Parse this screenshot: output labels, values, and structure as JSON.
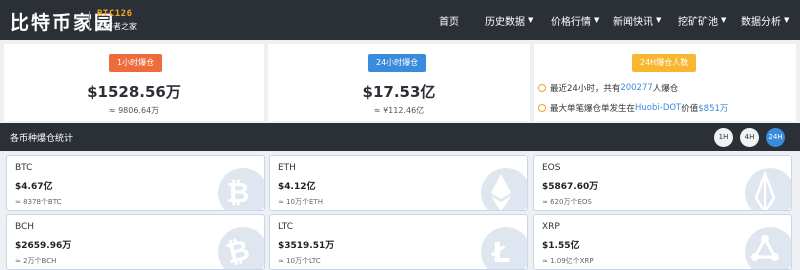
{
  "header": {
    "logo_text": "比特币家园",
    "logo_sub_en": "BTC126",
    "logo_sub_cn": "爱好者之家",
    "nav": [
      {
        "label": "首页",
        "caret": false
      },
      {
        "label": "历史数据",
        "caret": true
      },
      {
        "label": "价格行情",
        "caret": true
      },
      {
        "label": "新闻快讯",
        "caret": true
      },
      {
        "label": "挖矿矿池",
        "caret": true
      },
      {
        "label": "数据分析",
        "caret": true
      }
    ]
  },
  "stats": {
    "hour1": {
      "badge": "1小时爆仓",
      "value": "$1528.56万",
      "cny": "≈ 9806.64万",
      "badge_color": "#ee6b3b"
    },
    "hour24": {
      "badge": "24小时爆仓",
      "value": "$17.53亿",
      "cny": "≈ ¥112.46亿",
      "badge_color": "#3b8bdc"
    },
    "people": {
      "badge": "24H爆仓人数",
      "badge_color": "#f7b731",
      "line1_a": "最近24小时，共有",
      "line1_num": "200277",
      "line1_b": "人爆仓",
      "line2_a": "最大单笔爆仓单发生在",
      "line2_ex": "Huobi-DOT",
      "line2_b": "价值",
      "line2_val": "$851万"
    }
  },
  "section": {
    "title": "各币种爆仓统计",
    "periods": [
      {
        "label": "1H",
        "active": false
      },
      {
        "label": "4H",
        "active": false
      },
      {
        "label": "24H",
        "active": true
      }
    ]
  },
  "coins": [
    {
      "name": "BTC",
      "value": "$4.67亿",
      "sub": "≈ 8378个BTC",
      "icon": "bitcoin-icon"
    },
    {
      "name": "ETH",
      "value": "$4.12亿",
      "sub": "≈ 10万个ETH",
      "icon": "ethereum-icon"
    },
    {
      "name": "EOS",
      "value": "$5867.60万",
      "sub": "≈ 620万个EOS",
      "icon": "eos-icon"
    },
    {
      "name": "BCH",
      "value": "$2659.96万",
      "sub": "≈ 2万个BCH",
      "icon": "bitcoin-cash-icon"
    },
    {
      "name": "LTC",
      "value": "$3519.51万",
      "sub": "≈ 10万个LTC",
      "icon": "litecoin-icon"
    },
    {
      "name": "XRP",
      "value": "$1.55亿",
      "sub": "≈ 1.09亿个XRP",
      "icon": "ripple-icon"
    }
  ]
}
